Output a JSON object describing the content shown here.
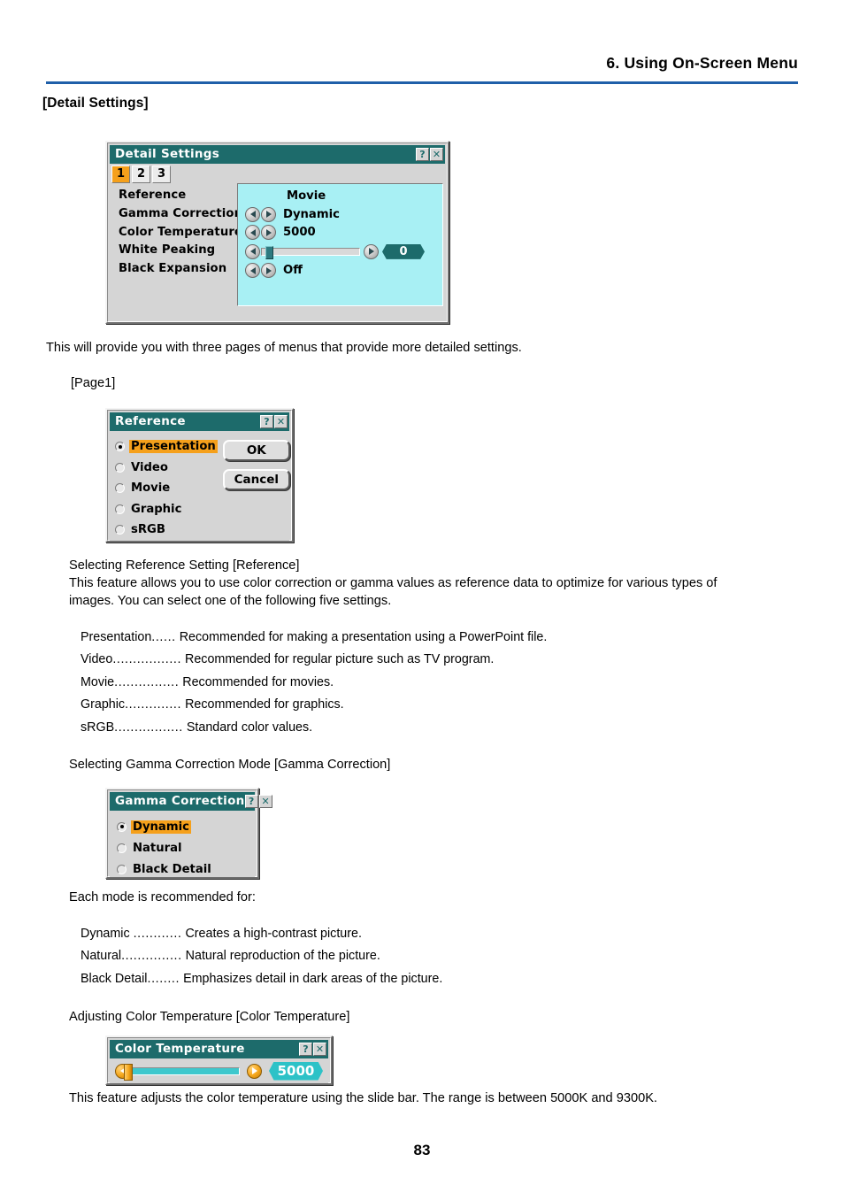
{
  "header": {
    "title": "6. Using On-Screen Menu",
    "rule_color": "#1f5fa9"
  },
  "section": {
    "heading": "[Detail Settings]"
  },
  "intro": {
    "paragraph": "This will provide you with three pages of menus that provide more detailed settings.",
    "page_label": "[Page1]"
  },
  "detail_settings_window": {
    "title": "Detail Settings",
    "help_btn": "?",
    "close_btn": "✕",
    "tabs": [
      {
        "label": "1",
        "active": true
      },
      {
        "label": "2",
        "active": false
      },
      {
        "label": "3",
        "active": false
      }
    ],
    "menu_items": [
      "Reference",
      "Gamma Correction",
      "Color Temperature",
      "White Peaking",
      "Black Expansion"
    ],
    "values": {
      "reference": "Movie",
      "gamma_correction": "Dynamic",
      "color_temperature": "5000",
      "white_peaking": "0",
      "black_expansion": "Off"
    },
    "white_peaking_slider_percent": 4
  },
  "reference_dialog": {
    "title": "Reference",
    "help_btn": "?",
    "close_btn": "✕",
    "options": [
      {
        "label": "Presentation",
        "selected": true
      },
      {
        "label": "Video",
        "selected": false
      },
      {
        "label": "Movie",
        "selected": false
      },
      {
        "label": "Graphic",
        "selected": false
      },
      {
        "label": "sRGB",
        "selected": false
      }
    ],
    "ok_label": "OK",
    "cancel_label": "Cancel"
  },
  "reference_text": {
    "heading": "Selecting Reference Setting [Reference]",
    "paragraph_line1": "This feature allows you to use color correction or gamma values as reference data to optimize for various types of",
    "paragraph_line2": "images. You can select one of the following five settings.",
    "definitions": [
      {
        "term": "Presentation",
        "dots": "......",
        "desc": "Recommended for making a presentation using a PowerPoint file."
      },
      {
        "term": "Video",
        "dots": ".................",
        "desc": "Recommended for regular picture such as TV program."
      },
      {
        "term": "Movie",
        "dots": "................",
        "desc": "Recommended for movies."
      },
      {
        "term": "Graphic",
        "dots": "..............",
        "desc": "Recommended for graphics."
      },
      {
        "term": "sRGB",
        "dots": ".................",
        "desc": "Standard color values."
      }
    ]
  },
  "gamma_text": {
    "heading": "Selecting Gamma Correction Mode [Gamma Correction]",
    "intro": "Each mode is recommended for:",
    "definitions": [
      {
        "term": "Dynamic",
        "dots": "............",
        "desc": "Creates a high-contrast picture."
      },
      {
        "term": "Natural",
        "dots": "...............",
        "desc": "Natural reproduction of the picture."
      },
      {
        "term": "Black Detail",
        "dots": "........",
        "desc": "Emphasizes detail in dark areas of the picture."
      }
    ]
  },
  "gamma_dialog": {
    "title": "Gamma Correction",
    "help_btn": "?",
    "close_btn": "✕",
    "options": [
      {
        "label": "Dynamic",
        "selected": true
      },
      {
        "label": "Natural",
        "selected": false
      },
      {
        "label": "Black Detail",
        "selected": false
      }
    ]
  },
  "colortemp_text": {
    "heading": "Adjusting Color Temperature [Color Temperature]",
    "paragraph": "This feature adjusts the color temperature using the slide bar. The range is between 5000K and 9300K."
  },
  "colortemp_dialog": {
    "title": "Color Temperature",
    "help_btn": "?",
    "close_btn": "✕",
    "value": "5000",
    "slider_percent": 0
  },
  "footer": {
    "page_number": "83"
  },
  "colors": {
    "titlebar": "#1d6b6b",
    "window_face": "#d5d5d5",
    "panel_cyan": "#a8f0f4",
    "highlight_orange": "#f5a01b",
    "badge_teal": "#2dc2c7",
    "rule_blue": "#1f5fa9"
  }
}
